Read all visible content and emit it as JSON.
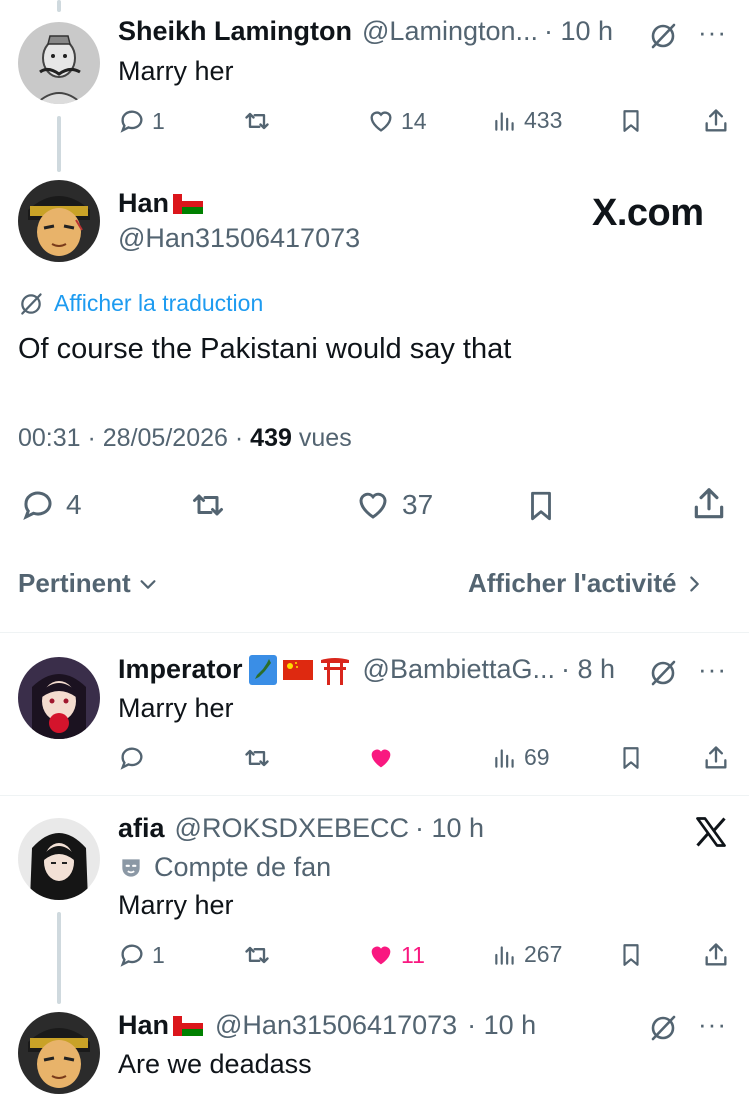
{
  "tweets": [
    {
      "name": "Sheikh Lamington",
      "handle": "@Lamington...",
      "time": "· 10 h",
      "text": "Marry her",
      "replies": "1",
      "likes": "14",
      "views": "433"
    },
    {
      "name": "Imperator",
      "handle": "@BambiettaG...",
      "time": "· 8 h",
      "text": "Marry her",
      "replies": "",
      "likes": "",
      "views": "69"
    },
    {
      "name": "afia",
      "handle": "@ROKSDXEBECC",
      "time": "· 10 h",
      "fan_badge": "Compte de fan",
      "text": "Marry her",
      "replies": "1",
      "likes": "11",
      "views": "267"
    },
    {
      "name": "Han",
      "handle": "@Han31506417073",
      "time": "· 10 h",
      "text": "Are we deadass"
    }
  ],
  "main": {
    "name": "Han",
    "handle": "@Han31506417073",
    "watermark": "X.com",
    "translate": "Afficher la traduction",
    "text": "Of course the Pakistani would say that",
    "time": "00:31 · 28/05/2026 ·",
    "views_count": "439",
    "views_label": "vues",
    "replies": "4",
    "likes": "37"
  },
  "sort": {
    "label": "Pertinent",
    "activity": "Afficher l'activité"
  },
  "colors": {
    "text": "#0f1419",
    "secondary": "#536471",
    "accent": "#1d9bf0",
    "like": "#f91880"
  }
}
